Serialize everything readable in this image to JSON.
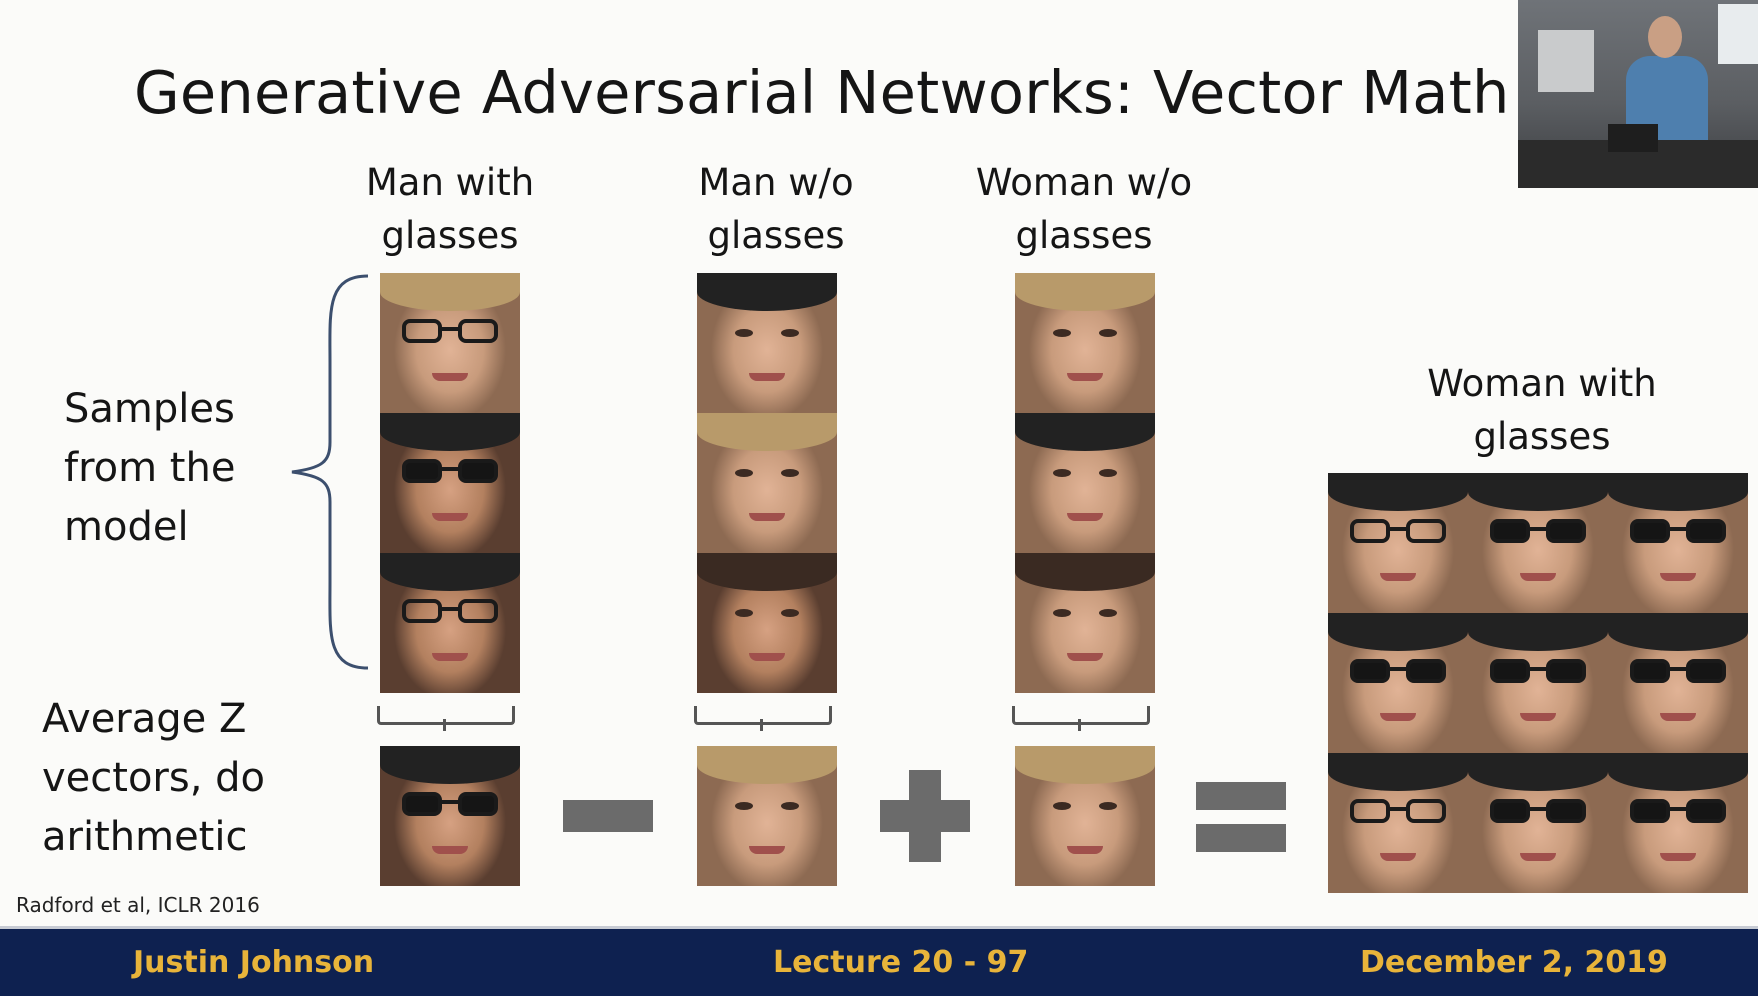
{
  "slide": {
    "title": "Generative Adversarial Networks: Vector Math",
    "columns": {
      "man_with_glasses": "Man with glasses",
      "man_without_glasses": "Man w/o glasses",
      "woman_without_glasses": "Woman w/o glasses",
      "woman_with_glasses": "Woman with glasses"
    },
    "samples_label": "Samples from the model",
    "average_label": "Average Z vectors, do arithmetic",
    "operators": [
      "minus",
      "plus",
      "equals"
    ],
    "citation": "Radford et al, ICLR 2016"
  },
  "footer": {
    "author": "Justin Johnson",
    "lecture": "Lecture 20 - 97",
    "date": "December 2, 2019"
  },
  "colors": {
    "footer_bg": "#0e2150",
    "footer_text": "#e8b43a",
    "operator": "#6b6b6b",
    "brace": "#3c4f6e"
  }
}
